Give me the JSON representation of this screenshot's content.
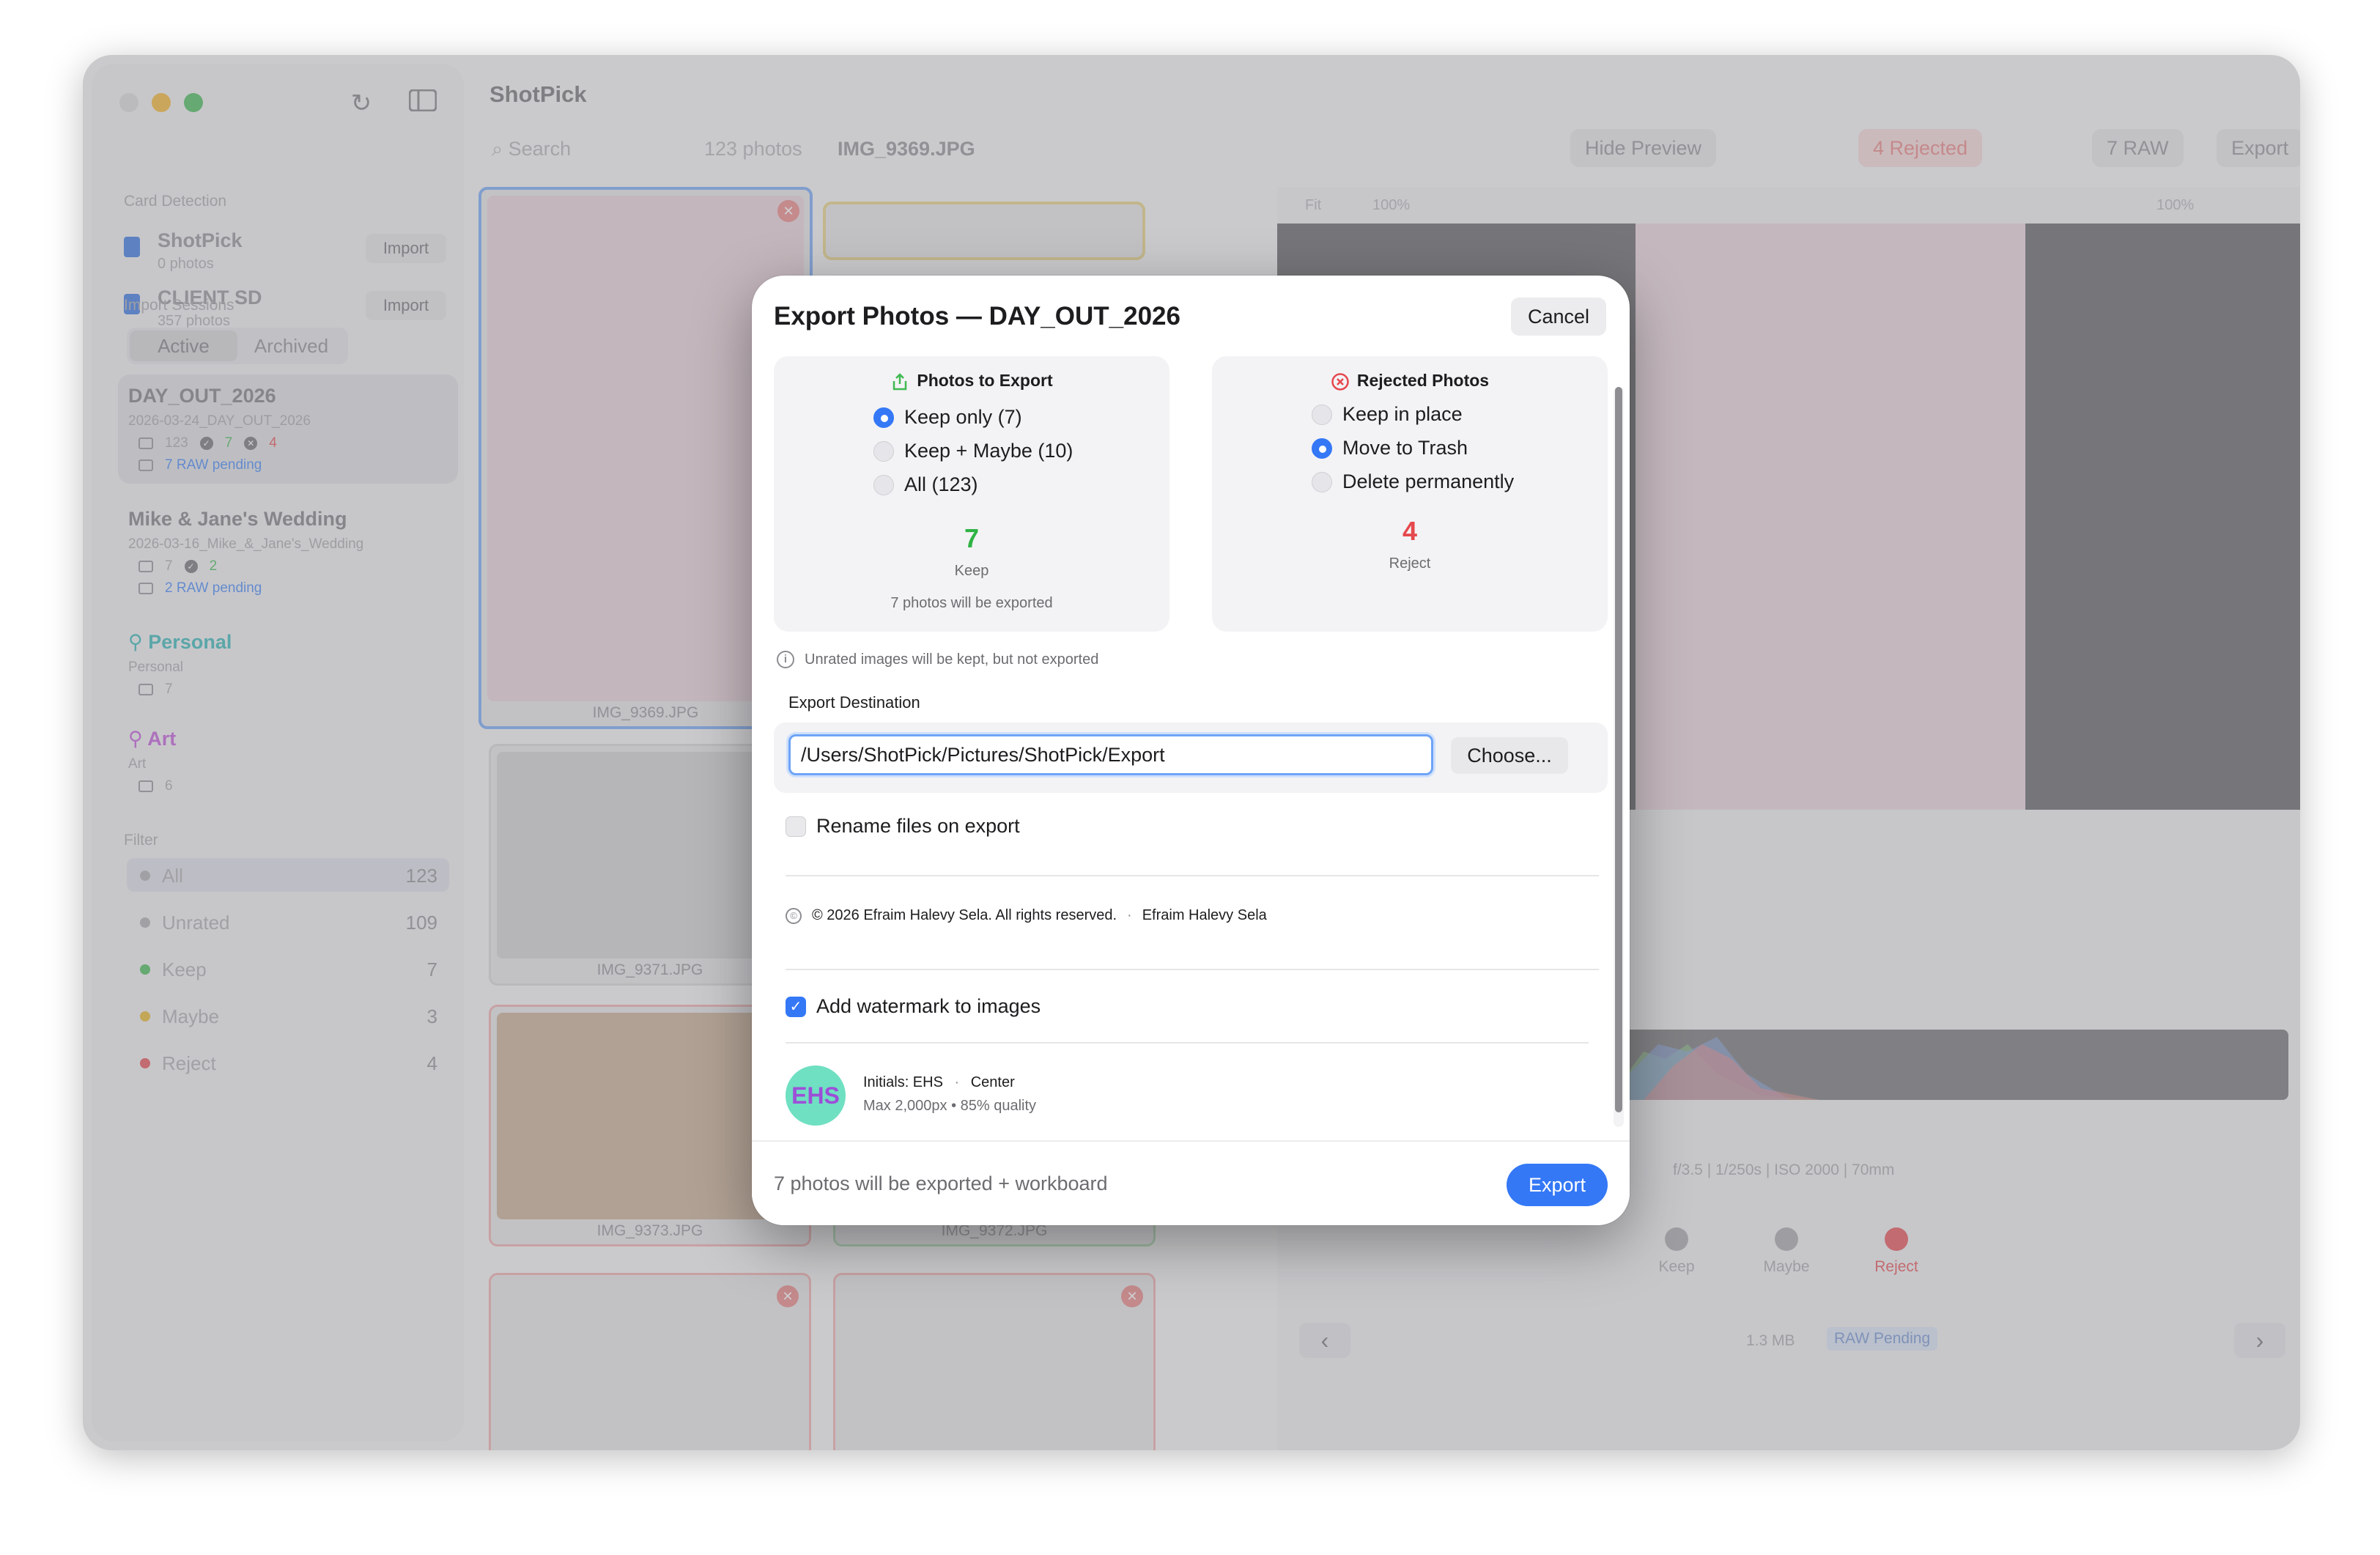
{
  "app": {
    "title": "ShotPick"
  },
  "sidebar": {
    "card_detection_label": "Card Detection",
    "cards": [
      {
        "name": "ShotPick",
        "count": "0 photos",
        "import_label": "Import"
      },
      {
        "name": "CLIENT SD",
        "count": "357 photos",
        "import_label": "Import"
      }
    ],
    "import_sessions_label": "Import Sessions",
    "segments": {
      "active": "Active",
      "archived": "Archived"
    },
    "sessions": [
      {
        "title": "DAY_OUT_2026",
        "folder": "2026-03-24_DAY_OUT_2026",
        "photos": "123",
        "keep": "7",
        "reject": "4",
        "raw": "7 RAW pending"
      },
      {
        "title": "Mike & Jane's Wedding",
        "folder": "2026-03-16_Mike_&_Jane's_Wedding",
        "photos": "7",
        "keep": "2",
        "raw": "2 RAW pending"
      }
    ],
    "albums": [
      {
        "title": "Personal",
        "subtitle": "Personal",
        "count": "7",
        "color": "#2bb3b3"
      },
      {
        "title": "Art",
        "subtitle": "Art",
        "count": "6",
        "color": "#c050d8"
      }
    ],
    "filter_label": "Filter",
    "filters": [
      {
        "label": "All",
        "count": "123",
        "color": "#a9a9ad"
      },
      {
        "label": "Unrated",
        "count": "109",
        "color": "#a9a9ad"
      },
      {
        "label": "Keep",
        "count": "7",
        "color": "#3fb950"
      },
      {
        "label": "Maybe",
        "count": "3",
        "color": "#e6b422"
      },
      {
        "label": "Reject",
        "count": "4",
        "color": "#e5484d"
      }
    ]
  },
  "toolbar": {
    "search_placeholder": "Search",
    "photo_count": "123 photos",
    "current_file": "IMG_9369.JPG",
    "hide_preview": "Hide Preview",
    "rejected": "4 Rejected",
    "raw": "7 RAW",
    "export": "Export"
  },
  "grid": {
    "thumbs": [
      {
        "name": "IMG_9369.JPG"
      },
      {
        "name": "IMG_9371.JPG"
      },
      {
        "name": "IMG_9373.JPG"
      },
      {
        "name": "IMG_9372.JPG"
      }
    ]
  },
  "preview": {
    "fit": "Fit",
    "zoom": "100%",
    "zoom_right": "100%",
    "exif": "f/3.5 | 1/250s | ISO 2000 | 70mm",
    "ratings": {
      "keep": "Keep",
      "maybe": "Maybe",
      "reject": "Reject"
    },
    "size": "1.3 MB",
    "raw_badge": "RAW Pending"
  },
  "dialog": {
    "title": "Export Photos — DAY_OUT_2026",
    "cancel": "Cancel",
    "photos_to_export": {
      "heading": "Photos to Export",
      "options": [
        "Keep only (7)",
        "Keep + Maybe (10)",
        "All (123)"
      ],
      "selected_index": 0,
      "big_number": "7",
      "big_label": "Keep",
      "summary": "7 photos will be exported"
    },
    "rejected_photos": {
      "heading": "Rejected Photos",
      "options": [
        "Keep in place",
        "Move to Trash",
        "Delete permanently"
      ],
      "selected_index": 1,
      "big_number": "4",
      "big_label": "Reject"
    },
    "unrated_note": "Unrated images will be kept, but not exported",
    "destination_label": "Export Destination",
    "destination_path": "/Users/ShotPick/Pictures/ShotPick/Export",
    "choose": "Choose...",
    "rename_label": "Rename files on export",
    "rename_checked": false,
    "copyright": "© 2026 Efraim Halevy Sela. All rights reserved.",
    "copyright_sep": "·",
    "author": "Efraim Halevy Sela",
    "watermark_label": "Add watermark to images",
    "watermark_checked": true,
    "watermark_initials_badge": "EHS",
    "watermark_line1": "Initials: EHS",
    "watermark_position": "Center",
    "watermark_line1_sep": "·",
    "watermark_line2": "Max 2,000px • 85% quality",
    "footer_text": "7 photos will be exported + workboard",
    "export": "Export",
    "accent": "#3478f6",
    "keep_color": "#2fb344",
    "reject_color": "#e5484d"
  }
}
